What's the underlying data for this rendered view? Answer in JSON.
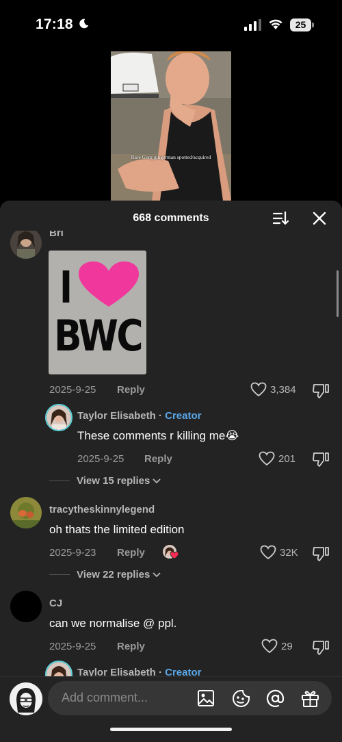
{
  "status": {
    "time": "17:18",
    "battery": "25"
  },
  "video": {
    "caption": "Rare Gorg gingerman spotted/acquired"
  },
  "sheet": {
    "title": "668 comments"
  },
  "comments": [
    {
      "username": "Bri",
      "sticker_text": [
        "I",
        "BWC"
      ],
      "date": "2025-9-25",
      "reply_label": "Reply",
      "likes": "3,384",
      "reply": {
        "username": "Taylor Elisabeth",
        "separator": "·",
        "badge": "Creator",
        "text": "These comments r killing me",
        "emoji": "😭",
        "date": "2025-9-25",
        "reply_label": "Reply",
        "likes": "201"
      },
      "view_replies": "View 15 replies"
    },
    {
      "username": "tracytheskinnylegend",
      "text": "oh thats the limited edition",
      "date": "2025-9-23",
      "reply_label": "Reply",
      "likes": "32K",
      "view_replies": "View 22 replies"
    },
    {
      "username": "CJ",
      "text": "can we normalise @ ppl.",
      "date": "2025-9-25",
      "reply_label": "Reply",
      "likes": "29",
      "reply": {
        "username": "Taylor Elisabeth",
        "separator": "·",
        "badge": "Creator"
      }
    }
  ],
  "composer": {
    "placeholder": "Add comment...",
    "icons": [
      "image-icon",
      "emoji-icon",
      "mention-icon",
      "gift-icon"
    ]
  },
  "colors": {
    "accent_creator": "#5aa7e8",
    "sheet_bg": "#232323",
    "heart_pink": "#f0389c"
  }
}
